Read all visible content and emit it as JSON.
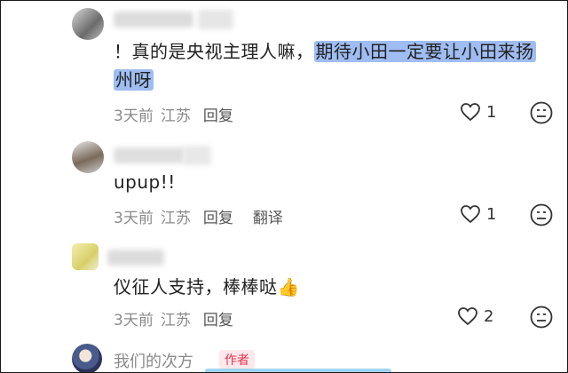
{
  "comments": [
    {
      "text_plain": "！真的是央视主理人嘛，",
      "text_highlight_1": "期待小田一定要让小田来扬",
      "text_highlight_2": "州呀",
      "time": "3天前",
      "location": "江苏",
      "reply": "回复",
      "likes": "1"
    },
    {
      "text": "upup!!",
      "time": "3天前",
      "location": "江苏",
      "reply": "回复",
      "translate": "翻译",
      "likes": "1"
    },
    {
      "text": "仪征人支持，棒棒哒",
      "emoji": "👍",
      "time": "3天前",
      "location": "江苏",
      "reply": "回复",
      "likes": "2"
    }
  ],
  "author_comment": {
    "name": "我们的次方",
    "badge": "作者"
  },
  "colors": {
    "highlight": "#9fbdf2",
    "author_badge": "#e0364f"
  }
}
